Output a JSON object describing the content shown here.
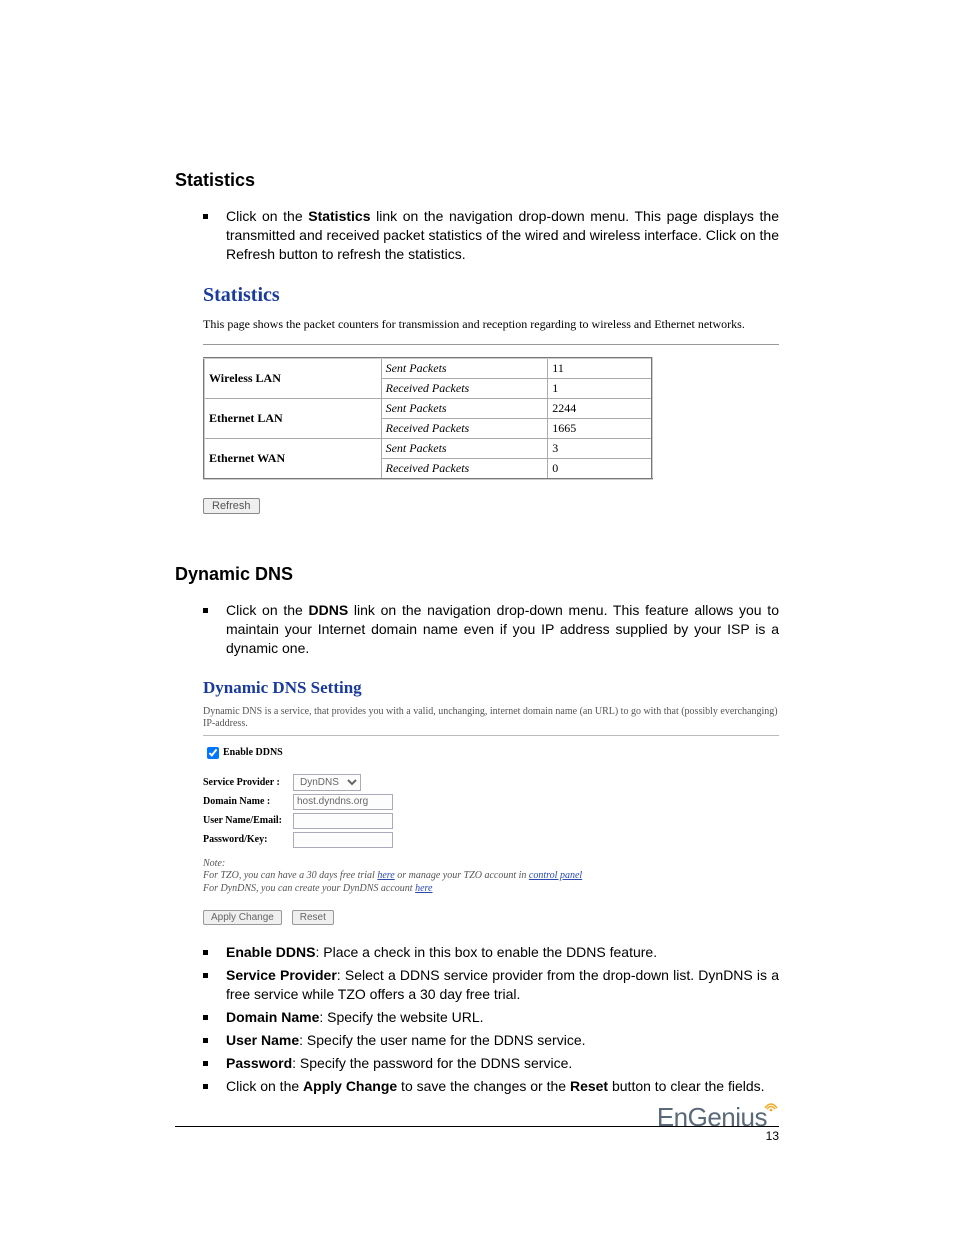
{
  "sections": {
    "statistics": {
      "heading": "Statistics",
      "intro_pre": "Click on the ",
      "intro_bold": "Statistics",
      "intro_post": " link on the navigation drop-down menu. This page displays the transmitted and received packet statistics of the wired and wireless interface. Click on the Refresh button to refresh the statistics.",
      "panel_title": "Statistics",
      "panel_desc": "This page shows the packet counters for transmission and reception regarding to wireless and Ethernet networks.",
      "refresh_btn": "Refresh",
      "table": [
        {
          "iface": "Wireless LAN",
          "rows": [
            {
              "metric": "Sent Packets",
              "value": "11"
            },
            {
              "metric": "Received Packets",
              "value": "1"
            }
          ]
        },
        {
          "iface": "Ethernet LAN",
          "rows": [
            {
              "metric": "Sent Packets",
              "value": "2244"
            },
            {
              "metric": "Received Packets",
              "value": "1665"
            }
          ]
        },
        {
          "iface": "Ethernet WAN",
          "rows": [
            {
              "metric": "Sent Packets",
              "value": "3"
            },
            {
              "metric": "Received Packets",
              "value": "0"
            }
          ]
        }
      ]
    },
    "ddns": {
      "heading": "Dynamic DNS",
      "intro_pre": "Click on the ",
      "intro_bold": "DDNS",
      "intro_post": " link on the navigation drop-down menu. This feature allows you to maintain your Internet domain name even if you IP address supplied by your ISP is a dynamic one.",
      "panel_title": "Dynamic DNS  Setting",
      "panel_desc": "Dynamic DNS is a service, that provides you with a valid, unchanging, internet domain name (an URL) to go with that (possibly everchanging) IP-address.",
      "enable_label": "Enable DDNS",
      "form": {
        "service_label": "Service Provider :",
        "service_value": "DynDNS",
        "domain_label": "Domain Name :",
        "domain_value": "host.dyndns.org",
        "user_label": "User Name/Email:",
        "user_value": "",
        "pass_label": "Password/Key:",
        "pass_value": ""
      },
      "note_head": "Note:",
      "note_line1_a": "For TZO, you can have a 30 days free trial ",
      "note_line1_link1": "here",
      "note_line1_b": " or manage your TZO account in ",
      "note_line1_link2": "control panel",
      "note_line2_a": "For DynDNS, you can create your DynDNS account ",
      "note_line2_link": "here",
      "apply_btn": "Apply Change",
      "reset_btn": "Reset",
      "bullets": [
        {
          "bold": "Enable DDNS",
          "text": ": Place a check in this box to enable the DDNS feature."
        },
        {
          "bold": "Service Provider",
          "text": ": Select a DDNS service provider from the drop-down list. DynDNS is a free service while TZO offers a 30 day free trial."
        },
        {
          "bold": "Domain Name",
          "text": ": Specify the website URL."
        },
        {
          "bold": "User Name",
          "text": ": Specify the user name for the DDNS service."
        },
        {
          "bold": "Password",
          "text": ": Specify the password for the DDNS service."
        }
      ],
      "final_pre": "Click on the ",
      "final_b1": "Apply Change",
      "final_mid": " to save the changes or the ",
      "final_b2": "Reset",
      "final_post": " button to clear the fields."
    }
  },
  "footer": {
    "logo": "EnGenius",
    "page": "13"
  }
}
